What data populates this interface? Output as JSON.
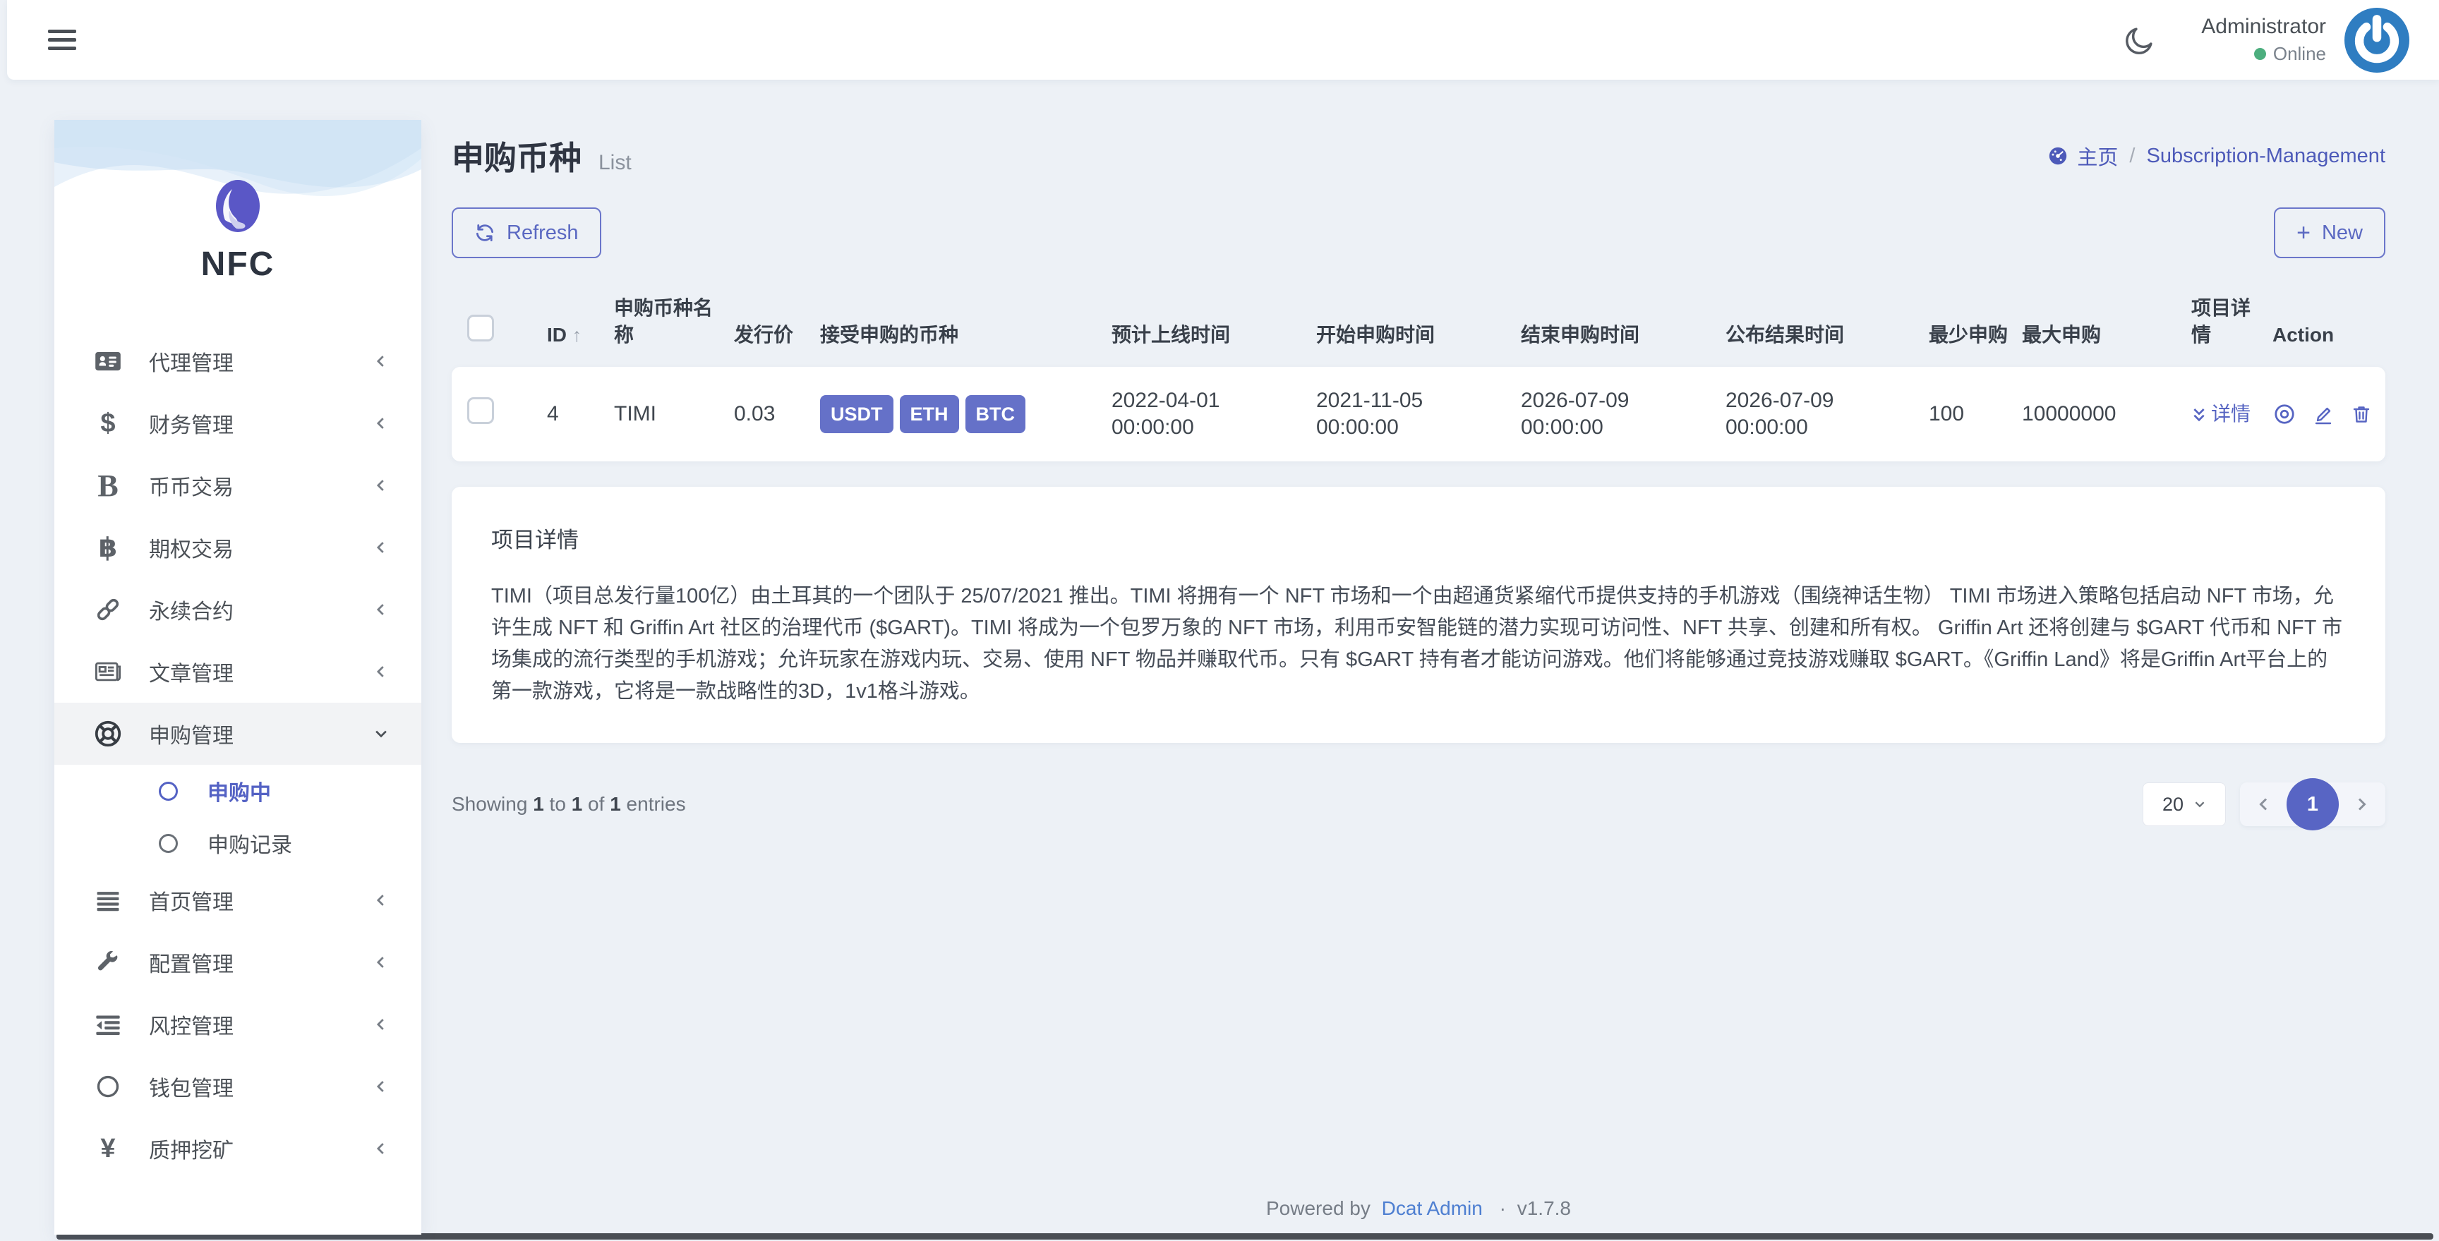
{
  "navbar": {
    "user_name": "Administrator",
    "user_status": "Online"
  },
  "sidebar": {
    "brand": "NFC",
    "items": [
      {
        "label": "代理管理",
        "icon": "id-card-icon"
      },
      {
        "label": "财务管理",
        "icon": "dollar-icon"
      },
      {
        "label": "币币交易",
        "icon": "letter-b-icon"
      },
      {
        "label": "期权交易",
        "icon": "bitcoin-icon"
      },
      {
        "label": "永续合约",
        "icon": "chain-icon"
      },
      {
        "label": "文章管理",
        "icon": "newspaper-icon"
      },
      {
        "label": "申购管理",
        "icon": "life-ring-icon"
      },
      {
        "label": "首页管理",
        "icon": "bars-icon"
      },
      {
        "label": "配置管理",
        "icon": "wrench-icon"
      },
      {
        "label": "风控管理",
        "icon": "outdent-icon"
      },
      {
        "label": "钱包管理",
        "icon": "circle-icon"
      },
      {
        "label": "质押挖矿",
        "icon": "yen-icon"
      }
    ],
    "submenu": [
      {
        "label": "申购中"
      },
      {
        "label": "申购记录"
      }
    ]
  },
  "page": {
    "title": "申购币种",
    "subtitle": "List",
    "breadcrumb": {
      "home": "主页",
      "separator": "/",
      "current": "Subscription-Management"
    },
    "toolbar": {
      "refresh": "Refresh",
      "new": "New"
    }
  },
  "table": {
    "columns": [
      "ID",
      "申购币种名称",
      "发行价",
      "接受申购的币种",
      "预计上线时间",
      "开始申购时间",
      "结束申购时间",
      "公布结果时间",
      "最少申购",
      "最大申购",
      "项目详情",
      "Action"
    ],
    "row": {
      "id": "4",
      "name": "TIMI",
      "price": "0.03",
      "currencies": [
        "USDT",
        "ETH",
        "BTC"
      ],
      "expected_launch": {
        "date": "2022-04-01",
        "time": "00:00:00"
      },
      "subscribe_start": {
        "date": "2021-11-05",
        "time": "00:00:00"
      },
      "subscribe_end": {
        "date": "2026-07-09",
        "time": "00:00:00"
      },
      "result_announce": {
        "date": "2026-07-09",
        "time": "00:00:00"
      },
      "min_subscribe": "100",
      "max_subscribe": "10000000",
      "details_link": "详情"
    }
  },
  "detail_panel": {
    "title": "项目详情",
    "content": "TIMI（项目总发行量100亿）由土耳其的一个团队于 25/07/2021 推出。TIMI 将拥有一个 NFT 市场和一个由超通货紧缩代币提供支持的手机游戏（围绕神话生物） TIMI 市场进入策略包括启动 NFT 市场，允许生成 NFT 和 Griffin Art 社区的治理代币 ($GART)。TIMI 将成为一个包罗万象的 NFT 市场，利用币安智能链的潜力实现可访问性、NFT 共享、创建和所有权。 Griffin Art 还将创建与 $GART 代币和 NFT 市场集成的流行类型的手机游戏；允许玩家在游戏内玩、交易、使用 NFT 物品并赚取代币。只有 $GART 持有者才能访问游戏。他们将能够通过竞技游戏赚取 $GART。《Griffin Land》将是Griffin Art平台上的第一款游戏，它将是一款战略性的3D，1v1格斗游戏。"
  },
  "pagination": {
    "showing": "Showing",
    "from": "1",
    "to_word": "to",
    "to": "1",
    "of_word": "of",
    "total": "1",
    "entries": "entries",
    "page_size": "20",
    "current_page": "1"
  },
  "footer": {
    "powered_by": "Powered by",
    "brand": "Dcat Admin",
    "separator": "·",
    "version": "v1.7.8"
  },
  "icons": {
    "sort_asc": "↑",
    "plus": "+",
    "dollar": "$",
    "letter_b": "B",
    "baht": "฿",
    "yen": "¥"
  },
  "colors": {
    "accent": "#5b69c2",
    "badge": "#6571c8",
    "online_green": "#4cae7e",
    "avatar_blue": "#2f7dc1",
    "breadcrumb": "#4d5ab9"
  }
}
